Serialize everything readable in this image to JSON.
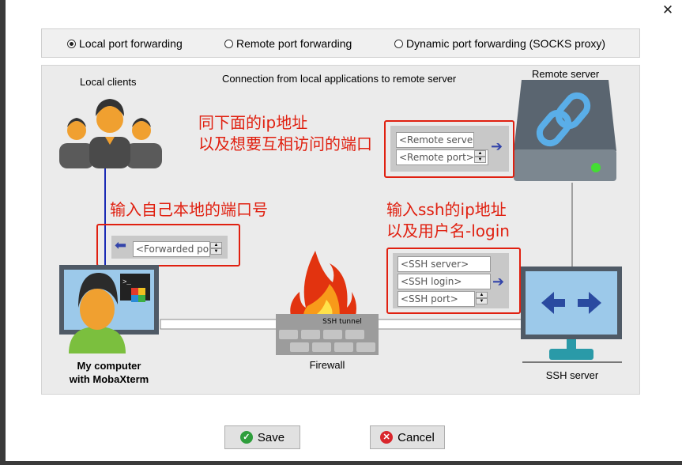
{
  "modes": {
    "local": "Local port forwarding",
    "remote": "Remote port forwarding",
    "dynamic": "Dynamic port forwarding (SOCKS proxy)",
    "selected": "local"
  },
  "diagram": {
    "caption": "Connection from local applications to remote server",
    "local_clients": "Local clients",
    "remote_server": "Remote server",
    "my_computer_line1": "My computer",
    "my_computer_line2": "with MobaXterm",
    "firewall": "Firewall",
    "ssh_tunnel": "SSH tunnel",
    "ssh_server": "SSH server"
  },
  "fields": {
    "remote_server_placeholder": "<Remote server>",
    "remote_port_placeholder": "<Remote port>",
    "forwarded_port_placeholder": "<Forwarded port>",
    "ssh_server_placeholder": "<SSH server>",
    "ssh_login_placeholder": "<SSH login>",
    "ssh_port_placeholder": "<SSH port>"
  },
  "notes": {
    "remote_line1": "同下面的ip地址",
    "remote_line2": "以及想要互相访问的端口",
    "local_port": "输入自己本地的端口号",
    "ssh_line1": "输入ssh的ip地址",
    "ssh_line2": "以及用户名-login"
  },
  "buttons": {
    "save": "Save",
    "cancel": "Cancel"
  },
  "colors": {
    "note_red": "#e02010",
    "save_icon": "#2e9e3c",
    "cancel_icon": "#d9262c",
    "arrow_blue": "#3344aa"
  }
}
